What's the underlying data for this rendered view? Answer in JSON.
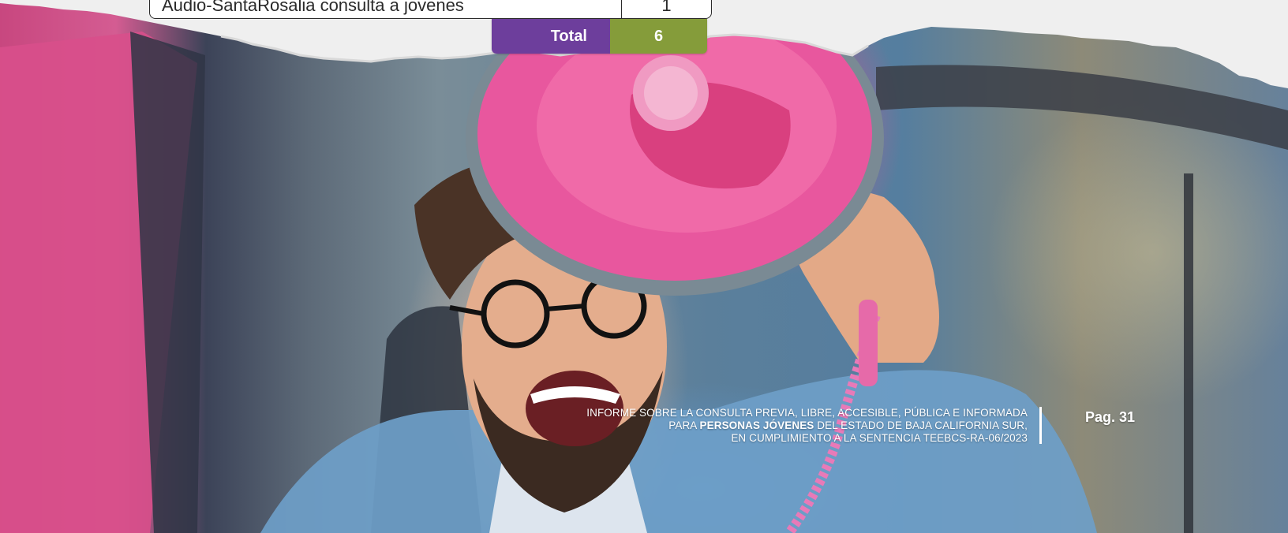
{
  "table": {
    "last_row": {
      "source": "Audio-SantaRosalia consulta a jovenes",
      "count": "1"
    },
    "total": {
      "label": "Total",
      "value": "6"
    }
  },
  "footer": {
    "line1": "INFORME SOBRE LA CONSULTA PREVIA, LIBRE, ACCESIBLE, PÚBLICA E INFORMADA",
    "line2_prefix": "PARA ",
    "line2_bold": "PERSONAS JÓVENES",
    "line2_suffix": " DEL ESTADO DE BAJA CALIFORNIA SUR,",
    "line3": "EN CUMPLIMIENTO A LA SENTENCIA TEEBCS-RA-06/2023"
  },
  "page": {
    "label": "Pag. 31"
  },
  "colors": {
    "total_label_bg": "#6d3e9c",
    "total_value_bg": "#859c3a",
    "paper": "#efefef",
    "megaphone_pink": "#e35a9f"
  },
  "background_photo": {
    "icon": "photo-young-man-with-megaphone-in-car"
  }
}
